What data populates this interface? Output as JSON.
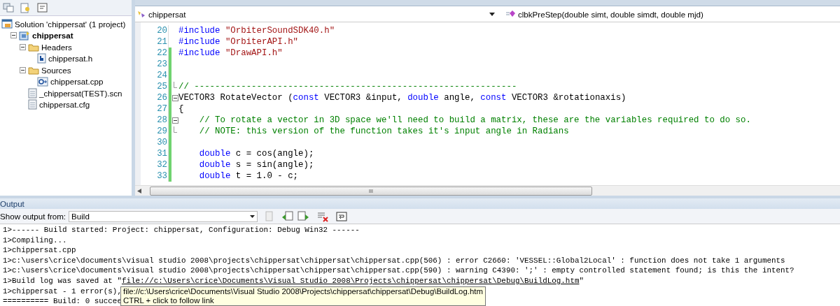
{
  "solution_explorer": {
    "tree": [
      {
        "label": "Solution 'chippersat' (1 project)",
        "kind": "solution",
        "children": [
          {
            "label": "chippersat",
            "kind": "project",
            "expanded": true,
            "children": [
              {
                "label": "Headers",
                "kind": "folder",
                "expanded": true,
                "children": [
                  {
                    "label": "chippersat.h",
                    "kind": "header"
                  }
                ]
              },
              {
                "label": "Sources",
                "kind": "folder",
                "expanded": true,
                "children": [
                  {
                    "label": "chippersat.cpp",
                    "kind": "cpp"
                  }
                ]
              },
              {
                "label": "_chippersat(TEST).scn",
                "kind": "file"
              },
              {
                "label": "chippersat.cfg",
                "kind": "file"
              }
            ]
          }
        ]
      }
    ]
  },
  "editor": {
    "class_dropdown": "chippersat",
    "member_dropdown": "clbkPreStep(double simt, double simdt, double mjd)",
    "lines": [
      {
        "number": "20",
        "changed": false,
        "segments": [
          {
            "kind": "keyword",
            "text": "#include "
          },
          {
            "kind": "string",
            "text": "\"OrbiterSoundSDK40.h\""
          }
        ]
      },
      {
        "number": "21",
        "changed": false,
        "segments": [
          {
            "kind": "keyword",
            "text": "#include "
          },
          {
            "kind": "string",
            "text": "\"OrbiterAPI.h\""
          }
        ]
      },
      {
        "number": "22",
        "changed": true,
        "segments": [
          {
            "kind": "keyword",
            "text": "#include "
          },
          {
            "kind": "string",
            "text": "\"DrawAPI.h\""
          }
        ]
      },
      {
        "number": "23",
        "changed": true
      },
      {
        "number": "24",
        "changed": true
      },
      {
        "number": "25",
        "block_end": true,
        "changed": true,
        "segments": [
          {
            "kind": "comment",
            "text": "// --------------------------------------------------------------"
          }
        ]
      },
      {
        "number": "26",
        "expanded": true,
        "changed": true,
        "segments": [
          {
            "kind": "plain",
            "text": "VECTOR3 RotateVector ("
          },
          {
            "kind": "keyword",
            "text": "const"
          },
          {
            "kind": "plain",
            "text": " VECTOR3 &input, "
          },
          {
            "kind": "keyword",
            "text": "double"
          },
          {
            "kind": "plain",
            "text": " angle, "
          },
          {
            "kind": "keyword",
            "text": "const"
          },
          {
            "kind": "plain",
            "text": " VECTOR3 &rotationaxis)"
          }
        ]
      },
      {
        "number": "27",
        "changed": true,
        "segments": [
          {
            "kind": "plain",
            "text": "{"
          }
        ]
      },
      {
        "number": "28",
        "expanded": true,
        "changed": true,
        "segments": [
          {
            "kind": "comment",
            "text": "    // To rotate a vector in 3D space we'll need to build a matrix, these are the variables required to do so."
          }
        ]
      },
      {
        "number": "29",
        "block_end": true,
        "changed": true,
        "segments": [
          {
            "kind": "comment",
            "text": "    // NOTE: this version of the function takes it's input angle in Radians"
          }
        ]
      },
      {
        "number": "30",
        "changed": true
      },
      {
        "number": "31",
        "changed": true,
        "segments": [
          {
            "kind": "keyword",
            "text": "    double"
          },
          {
            "kind": "plain",
            "text": " c = cos(angle);"
          }
        ]
      },
      {
        "number": "32",
        "changed": true,
        "segments": [
          {
            "kind": "keyword",
            "text": "    double"
          },
          {
            "kind": "plain",
            "text": " s = sin(angle);"
          }
        ]
      },
      {
        "number": "33",
        "changed": true,
        "segments": [
          {
            "kind": "keyword",
            "text": "    double"
          },
          {
            "kind": "plain",
            "text": " t = 1.0 - c;"
          }
        ]
      }
    ],
    "scroll_grip": "III"
  },
  "output": {
    "title": "Output",
    "show_from_label": "Show output from:",
    "source": "Build",
    "lines": [
      [
        {
          "kind": "plain",
          "text": "1>------ Build started: Project: chippersat, Configuration: Debug Win32 ------"
        }
      ],
      [
        {
          "kind": "plain",
          "text": "1>Compiling..."
        }
      ],
      [
        {
          "kind": "plain",
          "text": "1>chippersat.cpp"
        }
      ],
      [
        {
          "kind": "plain",
          "text": "1>c:\\users\\crice\\documents\\visual studio 2008\\projects\\chippersat\\chippersat\\chippersat.cpp(506) : error C2660: 'VESSEL::Global2Local' : function does not take 1 arguments"
        }
      ],
      [
        {
          "kind": "plain",
          "text": "1>c:\\users\\crice\\documents\\visual studio 2008\\projects\\chippersat\\chippersat\\chippersat.cpp(590) : warning C4390: ';' : empty controlled statement found; is this the intent?"
        }
      ],
      [
        {
          "kind": "plain",
          "text": "1>Build log was saved at \""
        },
        {
          "kind": "link",
          "text": "file://c:\\Users\\crice\\Documents\\Visual Studio 2008\\Projects\\chippersat\\chippersat\\Debug\\BuildLog.htm"
        },
        {
          "kind": "plain",
          "text": "\""
        }
      ],
      [
        {
          "kind": "plain",
          "text": "1>chippersat - 1 error(s),"
        }
      ],
      [
        {
          "kind": "plain",
          "text": "========== Build: 0 succee"
        }
      ]
    ],
    "tooltip": {
      "path": "file://c:\\Users\\crice\\Documents\\Visual Studio 2008\\Projects\\chippersat\\chippersat\\Debug\\BuildLog.htm",
      "hint": "CTRL + click to follow link"
    }
  }
}
